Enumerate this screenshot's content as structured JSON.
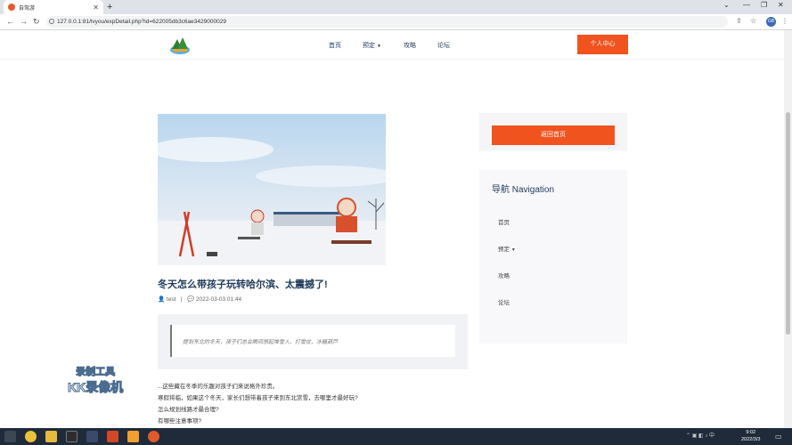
{
  "browser": {
    "tab_title": "自驾游",
    "url": "127.0.0.1:81/lvyou/expDetail.php?id=622005db3c6ae3429000029",
    "avatar_text": "GB"
  },
  "header": {
    "nav": [
      "首页",
      "预定",
      "攻略",
      "论坛"
    ],
    "user_center_label": "个人中心"
  },
  "post": {
    "title": "冬天怎么带孩子玩转哈尔滨、太震撼了!",
    "author": "test",
    "date": "2022-03-03 01:44",
    "quote": "提到东北的冬天，孩子们总会瞬间想起堆雪人、打雪仗、冰糖葫芦",
    "paragraphs": [
      "...这些藏在冬季的乐趣对孩子们来说格外珍贵。",
      "寒假将临，如果这个冬天，家长们想带着孩子来到东北赏雪，去哪里才最好玩?",
      "怎么规划线路才最合理?",
      "有哪些注意事项?"
    ]
  },
  "sidebar": {
    "back_home_label": "返回首页",
    "nav_heading": "导航 Navigation",
    "items": [
      "首页",
      "预定",
      "攻略",
      "论坛"
    ]
  },
  "watermark": {
    "line1": "录制工具",
    "line2": "KK录像机"
  },
  "taskbar": {
    "time": "9:02",
    "date": "2022/3/3"
  },
  "colors": {
    "accent": "#f1531f",
    "title": "#1e3958"
  }
}
